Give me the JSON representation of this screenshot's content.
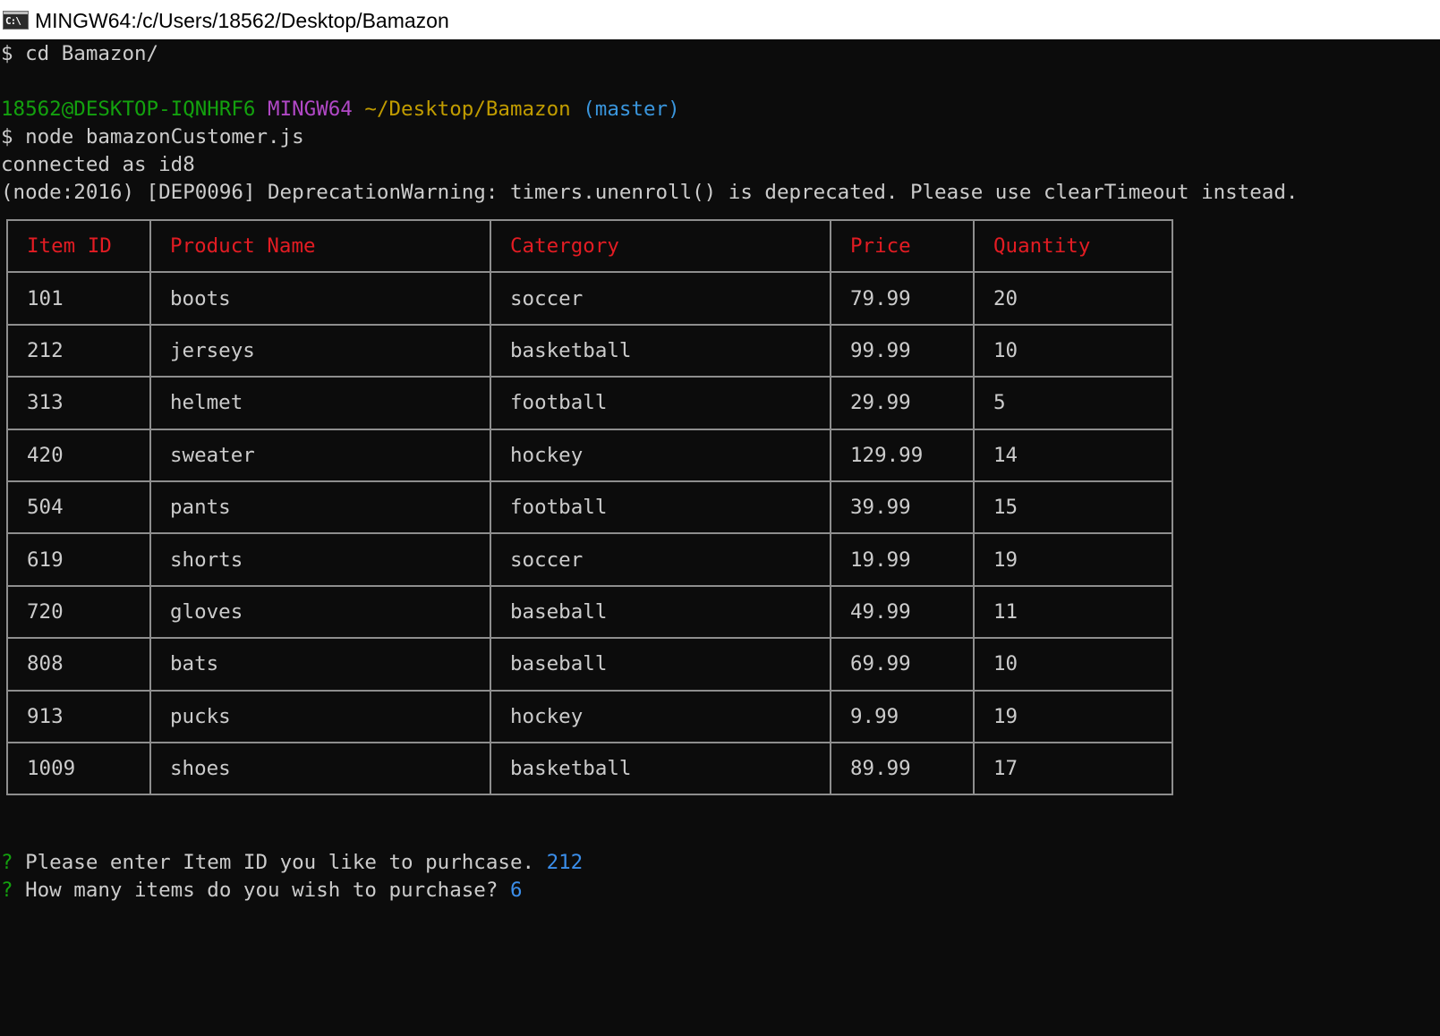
{
  "window": {
    "icon_label": "C:\\",
    "title": "MINGW64:/c/Users/18562/Desktop/Bamazon"
  },
  "console": {
    "line1": "$ cd Bamazon/",
    "prompt": {
      "user_host": "18562@DESKTOP-IQNHRF6",
      "shell": "MINGW64",
      "path": "~/Desktop/Bamazon",
      "branch": "(master)"
    },
    "line3": "$ node bamazonCustomer.js",
    "line4": "connected as id8",
    "line5": "(node:2016) [DEP0096] DeprecationWarning: timers.unenroll() is deprecated. Please use clearTimeout instead.",
    "question1": {
      "mark": "?",
      "text": "Please enter Item ID you like to purhcase.",
      "answer": "212"
    },
    "question2": {
      "mark": "?",
      "text": "How many items do you wish to purchase?",
      "answer": "6"
    }
  },
  "table": {
    "headers": [
      "Item ID",
      "Product Name",
      "Catergory",
      "Price",
      "Quantity"
    ],
    "rows": [
      [
        "101",
        "boots",
        "soccer",
        "79.99",
        "20"
      ],
      [
        "212",
        "jerseys",
        "basketball",
        "99.99",
        "10"
      ],
      [
        "313",
        "helmet",
        "football",
        "29.99",
        "5"
      ],
      [
        "420",
        "sweater",
        "hockey",
        "129.99",
        "14"
      ],
      [
        "504",
        "pants",
        "football",
        "39.99",
        "15"
      ],
      [
        "619",
        "shorts",
        "soccer",
        "19.99",
        "19"
      ],
      [
        "720",
        "gloves",
        "baseball",
        "49.99",
        "11"
      ],
      [
        "808",
        "bats",
        "baseball",
        "69.99",
        "10"
      ],
      [
        "913",
        "pucks",
        "hockey",
        "9.99",
        "19"
      ],
      [
        "1009",
        "shoes",
        "basketball",
        "89.99",
        "17"
      ]
    ]
  },
  "colors": {
    "background": "#0c0c0c",
    "foreground": "#cccccc",
    "header_red": "#e31c23",
    "prompt_green": "#13a10e",
    "prompt_magenta": "#b148c6",
    "prompt_yellow": "#c19c00",
    "prompt_cyan": "#3a96dd",
    "answer_blue": "#3b8eea"
  },
  "icons": {
    "window_icon": "terminal-icon"
  }
}
